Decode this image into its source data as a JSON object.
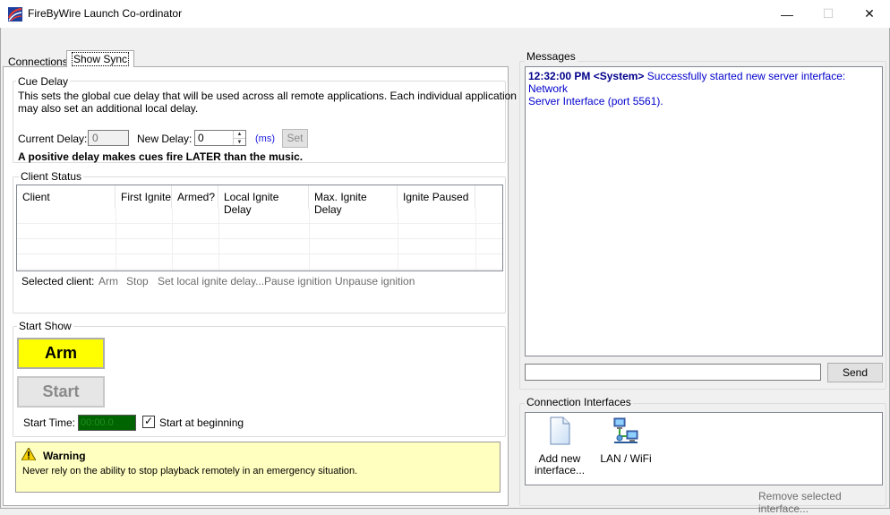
{
  "window": {
    "title": "FireByWire Launch Co-ordinator",
    "minimize": "—",
    "maximize": "☐",
    "close": "✕"
  },
  "tabs": [
    {
      "label": "Connections",
      "selected": false
    },
    {
      "label": "Show Sync",
      "selected": true
    }
  ],
  "cue_delay": {
    "legend": "Cue Delay",
    "description_line1": "This sets the global cue delay that will be used across all remote applications. Each individual application",
    "description_line2": "may also set an additional local delay.",
    "current_delay_label": "Current Delay:",
    "current_delay_value": "0",
    "new_delay_label": "New Delay:",
    "new_delay_value": "0",
    "unit_label": "(ms)",
    "set_label": "Set",
    "note": "A positive delay makes cues fire LATER than the music."
  },
  "client_status": {
    "legend": "Client Status",
    "columns": [
      "Client",
      "First Ignite",
      "Armed?",
      "Local Ignite Delay",
      "Max. Ignite Delay",
      "Ignite Paused"
    ],
    "rows": [],
    "selected_client_label": "Selected client:",
    "actions": [
      "Arm",
      "Stop",
      "Set local ignite delay...",
      "Pause ignition",
      "Unpause ignition"
    ]
  },
  "start_show": {
    "legend": "Start Show",
    "arm_label": "Arm",
    "start_label": "Start",
    "start_time_label": "Start Time:",
    "start_time_value": "00:00.0",
    "start_at_beginning_label": "Start at beginning",
    "start_at_beginning_checked": true,
    "arm_color": "#ffff00"
  },
  "warning": {
    "icon": "warning-icon",
    "title": "Warning",
    "text": "Never rely on the ability to stop playback remotely in an emergency situation.",
    "background": "#ffffc0"
  },
  "messages": {
    "legend": "Messages",
    "entries": [
      {
        "time": "12:32:00 PM",
        "source": "<System>",
        "text": "Successfully started new server interface: Network",
        "text_cont": "Server Interface (port 5561)."
      }
    ],
    "input_value": "",
    "send_label": "Send",
    "message_color": "#0000cc"
  },
  "connection_interfaces": {
    "legend": "Connection Interfaces",
    "items": [
      {
        "label_line1": "Add new",
        "label_line2": "interface...",
        "icon": "new-document-icon"
      },
      {
        "label_line1": "LAN / WiFi",
        "label_line2": "",
        "icon": "network-icon"
      }
    ],
    "remove_label": "Remove selected interface..."
  }
}
